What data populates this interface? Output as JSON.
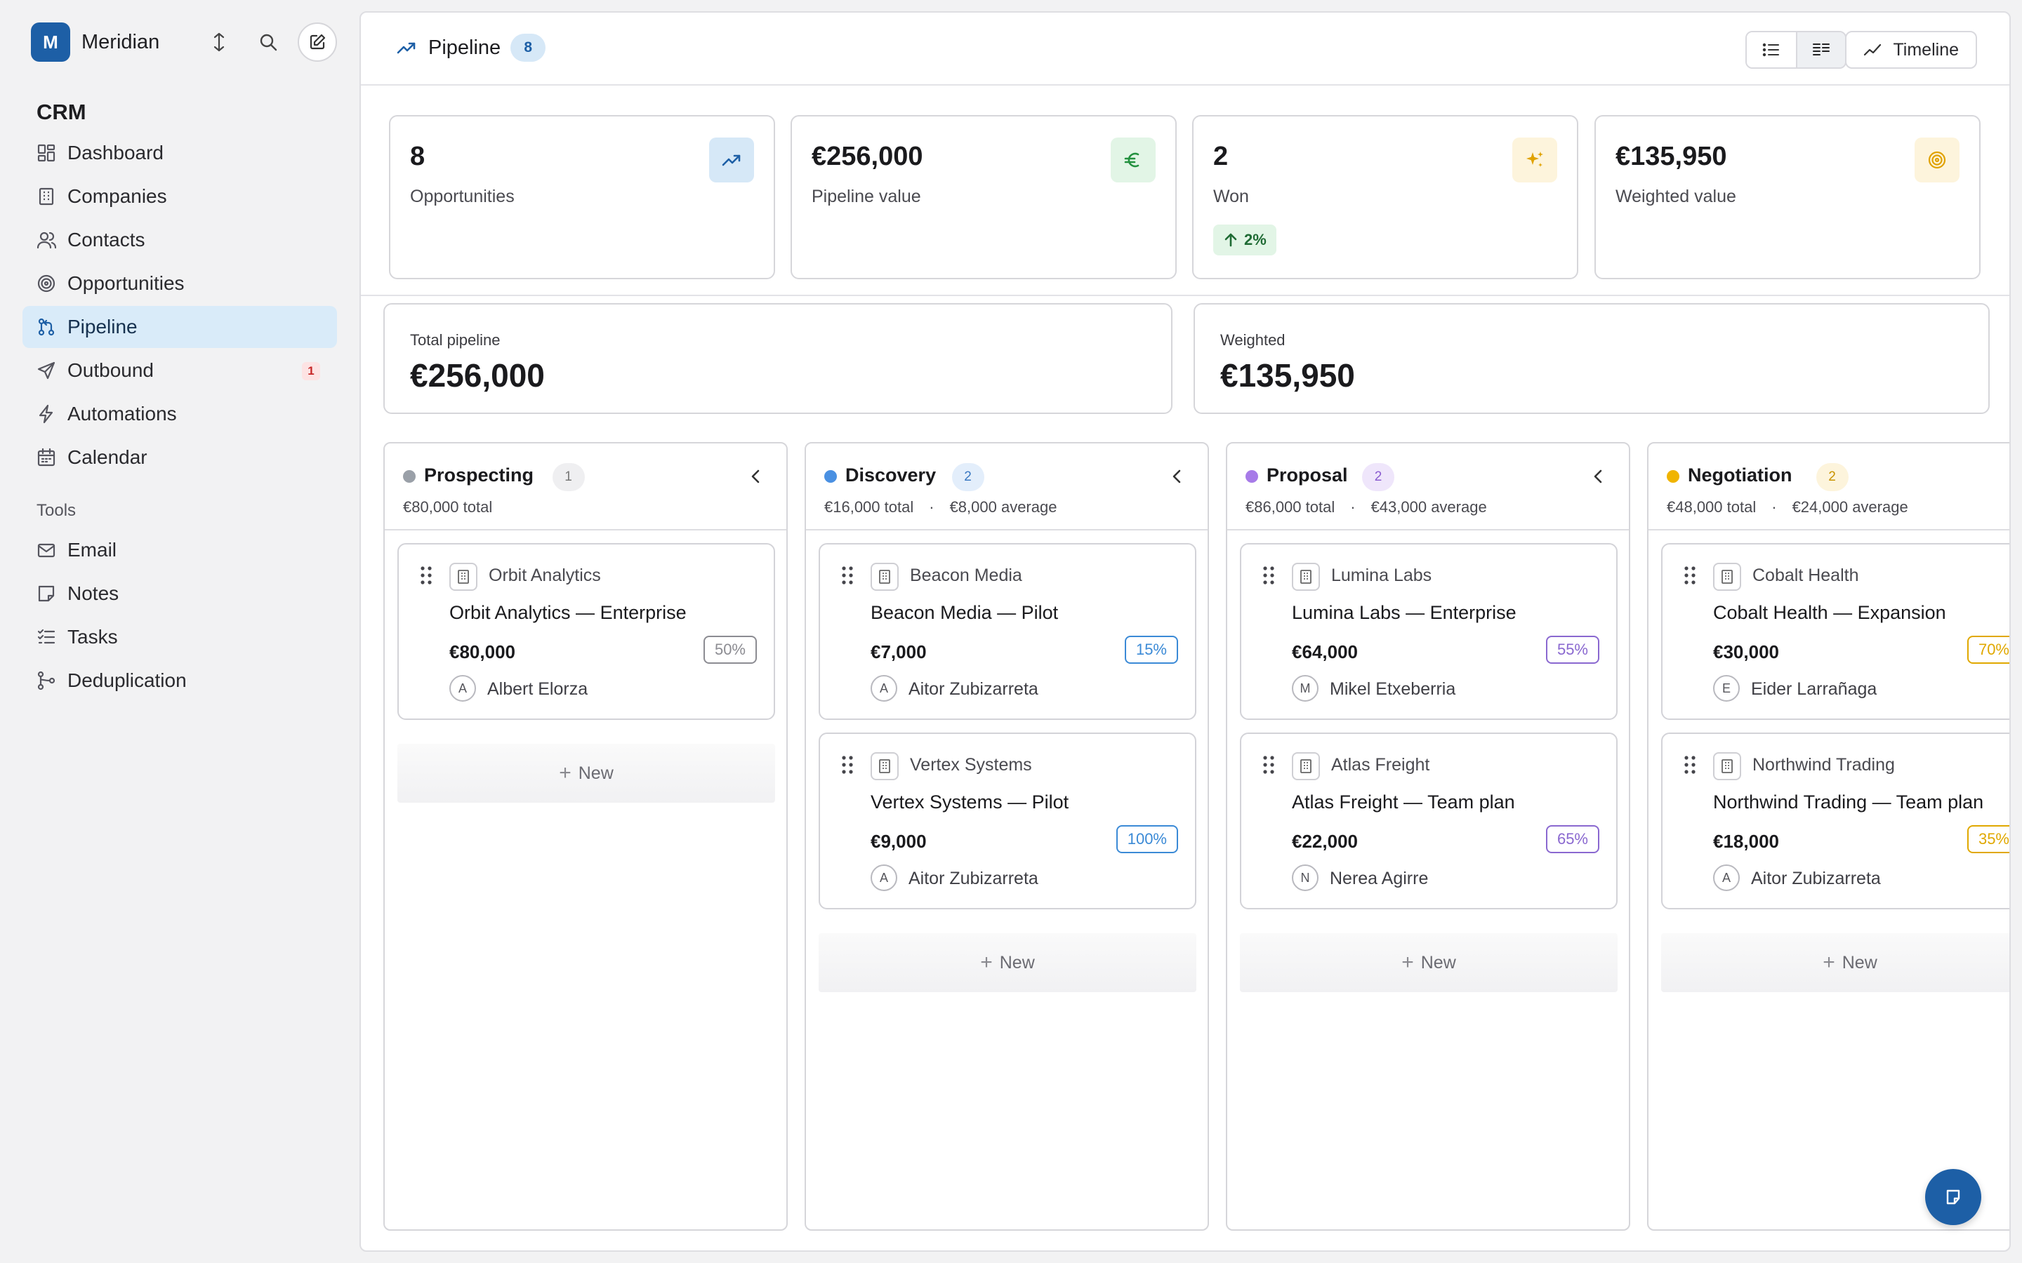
{
  "workspace": {
    "initial": "M",
    "name": "Meridian"
  },
  "sidebar": {
    "crm_title": "CRM",
    "crm_items": [
      {
        "label": "Dashboard",
        "icon": "dashboard-icon"
      },
      {
        "label": "Companies",
        "icon": "building-icon"
      },
      {
        "label": "Contacts",
        "icon": "users-icon"
      },
      {
        "label": "Opportunities",
        "icon": "target-icon"
      },
      {
        "label": "Pipeline",
        "icon": "pipeline-icon",
        "active": true
      },
      {
        "label": "Outbound",
        "icon": "send-icon",
        "badge": "1"
      },
      {
        "label": "Automations",
        "icon": "bolt-icon"
      },
      {
        "label": "Calendar",
        "icon": "calendar-icon"
      }
    ],
    "tools_title": "Tools",
    "tool_items": [
      {
        "label": "Email",
        "icon": "mail-icon"
      },
      {
        "label": "Notes",
        "icon": "note-icon"
      },
      {
        "label": "Tasks",
        "icon": "tasks-icon"
      },
      {
        "label": "Deduplication",
        "icon": "merge-icon"
      }
    ]
  },
  "header": {
    "title": "Pipeline",
    "count": "8",
    "timeline_label": "Timeline"
  },
  "stats": [
    {
      "value": "8",
      "label": "Opportunities",
      "icon": "trend-up-icon",
      "icon_bg": "#d6e8f7",
      "icon_color": "#1d5fa6"
    },
    {
      "value": "€256,000",
      "label": "Pipeline value",
      "icon": "euro-icon",
      "icon_bg": "#e2f5e6",
      "icon_color": "#23913f"
    },
    {
      "value": "2",
      "label": "Won",
      "icon": "sparkle-icon",
      "icon_bg": "#fdf4dc",
      "icon_color": "#e0a200",
      "delta": "2%"
    },
    {
      "value": "€135,950",
      "label": "Weighted value",
      "icon": "target-icon",
      "icon_bg": "#fdf4dc",
      "icon_color": "#e0a200"
    }
  ],
  "totals": {
    "total_label": "Total pipeline",
    "total_value": "€256,000",
    "weighted_label": "Weighted",
    "weighted_value": "€135,950"
  },
  "new_label": "New",
  "columns": [
    {
      "name": "Prospecting",
      "count": "1",
      "color": "#9aa0a8",
      "count_bg": "#efeff1",
      "count_color": "#777",
      "total": "€80,000 total",
      "sep": "",
      "average": "",
      "cards": [
        {
          "company": "Orbit Analytics",
          "title": "Orbit Analytics — Enterprise",
          "amount": "€80,000",
          "prob": "50%",
          "prob_color": "#8c8c92",
          "owner_initial": "A",
          "owner": "Albert Elorza"
        }
      ]
    },
    {
      "name": "Discovery",
      "count": "2",
      "color": "#4a90e2",
      "count_bg": "#e3eefb",
      "count_color": "#3a78c2",
      "total": "€16,000 total",
      "sep": "·",
      "average": "€8,000 average",
      "cards": [
        {
          "company": "Beacon Media",
          "title": "Beacon Media — Pilot",
          "amount": "€7,000",
          "prob": "15%",
          "prob_color": "#3b8ad6",
          "owner_initial": "A",
          "owner": "Aitor Zubizarreta"
        },
        {
          "company": "Vertex Systems",
          "title": "Vertex Systems — Pilot",
          "amount": "€9,000",
          "prob": "100%",
          "prob_color": "#3b8ad6",
          "owner_initial": "A",
          "owner": "Aitor Zubizarreta"
        }
      ]
    },
    {
      "name": "Proposal",
      "count": "2",
      "color": "#a77be8",
      "count_bg": "#efe6fb",
      "count_color": "#8a5cd0",
      "total": "€86,000 total",
      "sep": "·",
      "average": "€43,000 average",
      "cards": [
        {
          "company": "Lumina Labs",
          "title": "Lumina Labs — Enterprise",
          "amount": "€64,000",
          "prob": "55%",
          "prob_color": "#8a68d0",
          "owner_initial": "M",
          "owner": "Mikel Etxeberria"
        },
        {
          "company": "Atlas Freight",
          "title": "Atlas Freight — Team plan",
          "amount": "€22,000",
          "prob": "65%",
          "prob_color": "#8a68d0",
          "owner_initial": "N",
          "owner": "Nerea Agirre"
        }
      ]
    },
    {
      "name": "Negotiation",
      "count": "2",
      "color": "#f0b400",
      "count_bg": "#fdf4dc",
      "count_color": "#c99300",
      "total": "€48,000 total",
      "sep": "·",
      "average": "€24,000 average",
      "cards": [
        {
          "company": "Cobalt Health",
          "title": "Cobalt Health — Expansion",
          "amount": "€30,000",
          "prob": "70%",
          "prob_color": "#e0a800",
          "owner_initial": "E",
          "owner": "Eider Larrañaga"
        },
        {
          "company": "Northwind Trading",
          "title": "Northwind Trading — Team plan",
          "amount": "€18,000",
          "prob": "35%",
          "prob_color": "#e0a800",
          "owner_initial": "A",
          "owner": "Aitor Zubizarreta"
        }
      ]
    }
  ]
}
